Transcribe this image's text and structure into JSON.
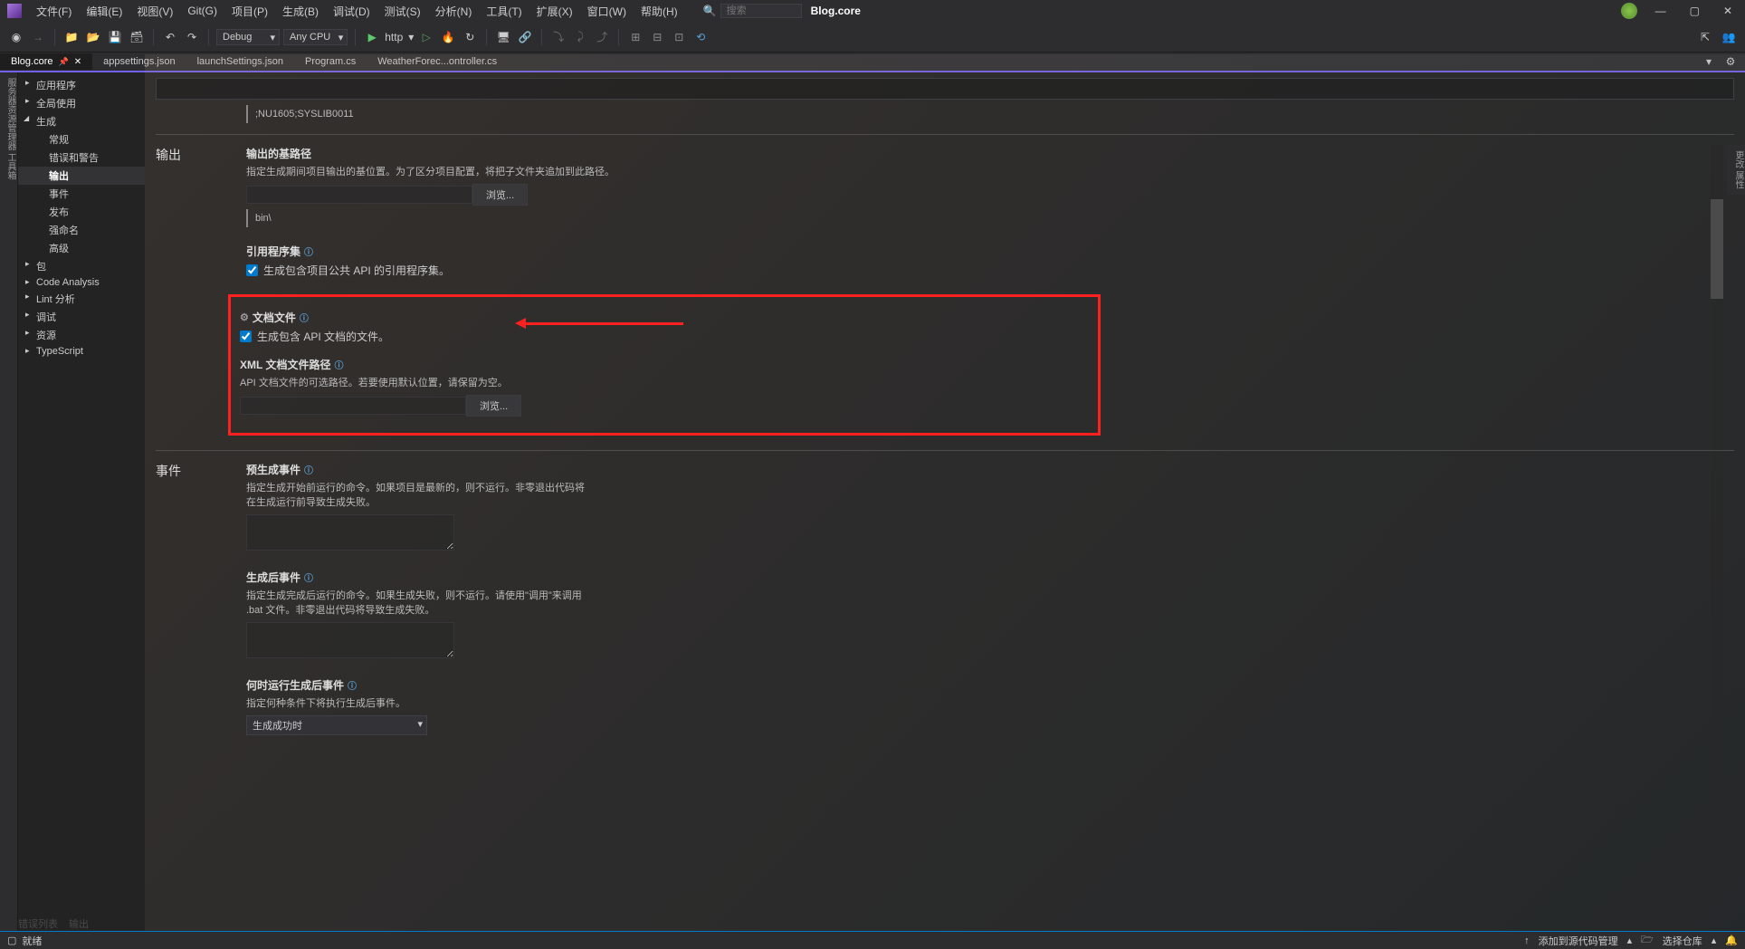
{
  "menu": [
    "文件(F)",
    "编辑(E)",
    "视图(V)",
    "Git(G)",
    "项目(P)",
    "生成(B)",
    "调试(D)",
    "测试(S)",
    "分析(N)",
    "工具(T)",
    "扩展(X)",
    "窗口(W)",
    "帮助(H)"
  ],
  "title_search_placeholder": "搜索",
  "title_project": "Blog.core",
  "toolbar": {
    "config": "Debug",
    "platform": "Any CPU",
    "launch": "http"
  },
  "tabs": [
    {
      "label": "Blog.core",
      "active": true,
      "pinned": true
    },
    {
      "label": "appsettings.json",
      "active": false
    },
    {
      "label": "launchSettings.json",
      "active": false
    },
    {
      "label": "Program.cs",
      "active": false
    },
    {
      "label": "WeatherForec...ontroller.cs",
      "active": false
    }
  ],
  "vtab_left": "服务器资源管理器  工具箱",
  "vtab_right": "更改  属性",
  "sidebar": {
    "items": [
      {
        "label": "应用程序",
        "expandable": true
      },
      {
        "label": "全局使用",
        "expandable": true
      },
      {
        "label": "生成",
        "expanded": true,
        "children": [
          "常规",
          "错误和警告",
          "输出",
          "事件",
          "发布",
          "强命名",
          "高级"
        ],
        "selected_child": "输出"
      },
      {
        "label": "包",
        "expandable": true
      },
      {
        "label": "Code Analysis",
        "expandable": true
      },
      {
        "label": "Lint 分析",
        "expandable": true
      },
      {
        "label": "调试",
        "expandable": true
      },
      {
        "label": "资源",
        "expandable": true
      },
      {
        "label": "TypeScript",
        "expandable": true
      }
    ]
  },
  "content": {
    "suppress_value": ";NU1605;SYSLIB0011",
    "output_section": "输出",
    "base_path_label": "输出的基路径",
    "base_path_desc": "指定生成期间项目输出的基位置。为了区分项目配置，将把子文件夹追加到此路径。",
    "browse": "浏览...",
    "base_path_value": "bin\\",
    "ref_asm_label": "引用程序集",
    "ref_asm_check": "生成包含项目公共 API 的引用程序集。",
    "doc_label": "文档文件",
    "doc_check": "生成包含 API 文档的文件。",
    "xml_label": "XML 文档文件路径",
    "xml_desc": "API 文档文件的可选路径。若要使用默认位置，请保留为空。",
    "events_section": "事件",
    "prebuild_label": "预生成事件",
    "prebuild_desc": "指定生成开始前运行的命令。如果项目是最新的，则不运行。非零退出代码将在生成运行前导致生成失败。",
    "postbuild_label": "生成后事件",
    "postbuild_desc": "指定生成完成后运行的命令。如果生成失败，则不运行。请使用\"调用\"来调用 .bat 文件。非零退出代码将导致生成失败。",
    "when_label": "何时运行生成后事件",
    "when_desc": "指定何种条件下将执行生成后事件。",
    "when_value": "生成成功时"
  },
  "bottom_tabs": [
    "错误列表",
    "输出"
  ],
  "status": {
    "ready": "就绪",
    "source_control": "添加到源代码管理",
    "repo": "选择仓库",
    "notif": "0"
  }
}
